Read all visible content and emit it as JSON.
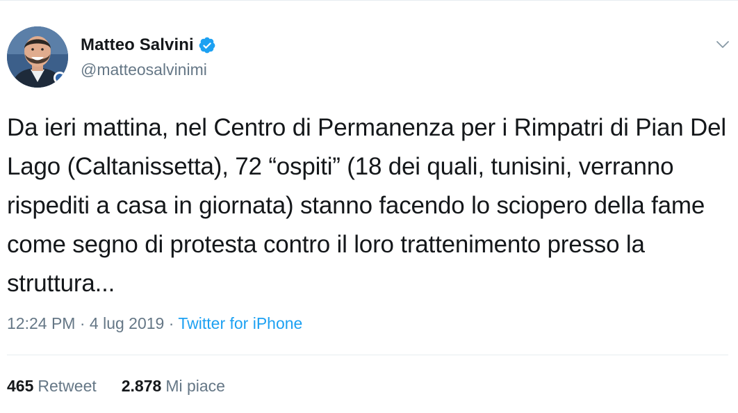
{
  "tweet": {
    "author": {
      "name": "Matteo Salvini",
      "handle": "@matteosalvinimi",
      "verified": true
    },
    "text": "Da ieri mattina, nel Centro di Permanenza per i Rimpatri di Pian Del Lago (Caltanissetta), 72 “ospiti” (18 dei quali, tunisini, verranno rispediti a casa in giornata) stanno facendo lo sciopero della fame come segno di protesta contro il loro trattenimento presso la struttura...",
    "meta": {
      "time": "12:24 PM",
      "separator_1": " · ",
      "date": "4 lug 2019",
      "separator_2": " · ",
      "source": "Twitter for iPhone"
    },
    "stats": {
      "retweets_count": "465",
      "retweets_label": "Retweet",
      "likes_count": "2.878",
      "likes_label": "Mi piace"
    }
  },
  "icons": {
    "verified": "verified-badge-icon",
    "more": "chevron-down-icon"
  },
  "colors": {
    "accent": "#1da1f2",
    "text_primary": "#14171a",
    "text_secondary": "#657786",
    "divider": "#e6ecf0"
  }
}
